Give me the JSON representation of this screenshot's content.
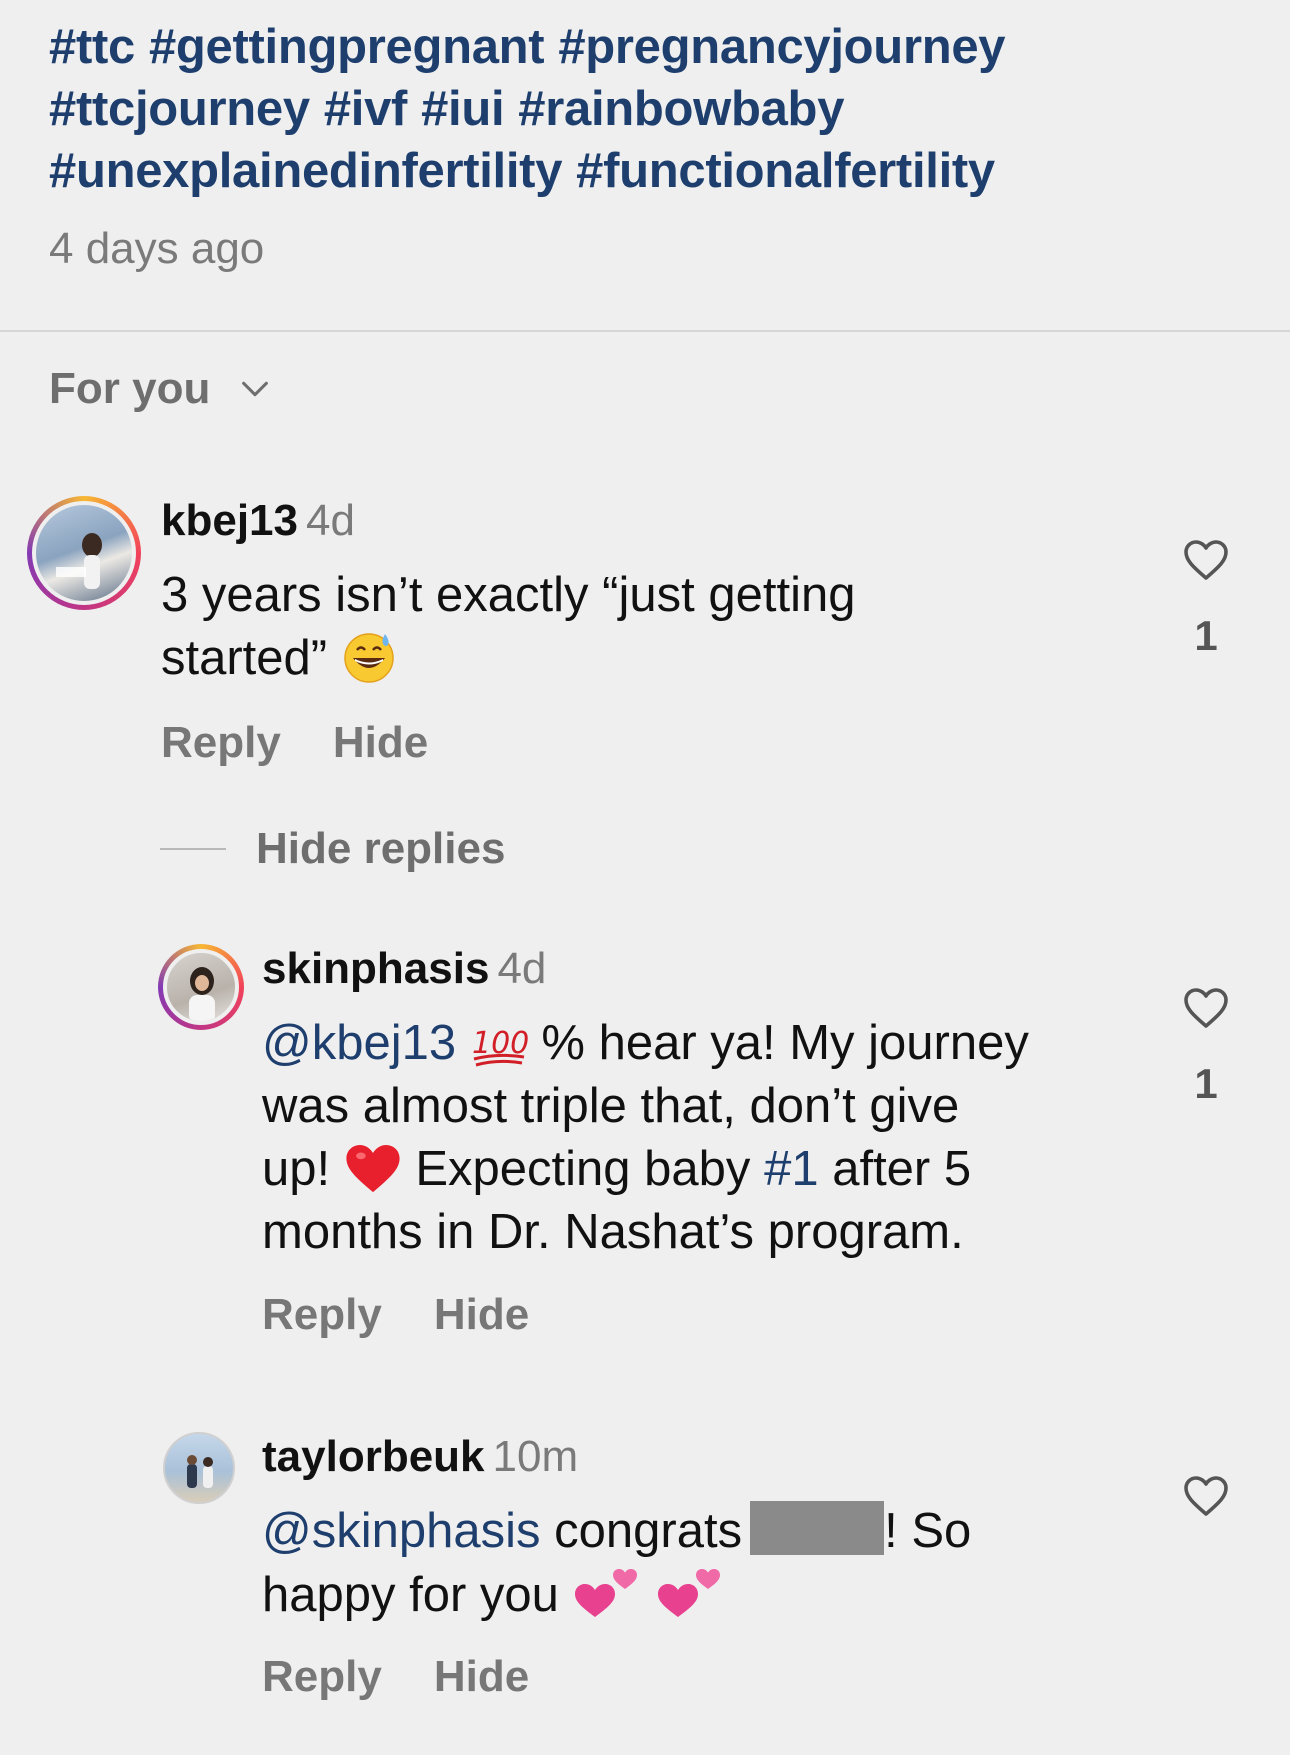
{
  "post": {
    "hashtags": [
      "#ttc",
      "#gettingpregnant",
      "#pregnancyjourney",
      "#ttcjourney",
      "#ivf",
      "#iui",
      "#rainbowbaby",
      "#unexplainedinfertility",
      "#functionalfertility"
    ],
    "time": "4 days ago"
  },
  "sort": {
    "label": "For you"
  },
  "comments": [
    {
      "user": "kbej13",
      "time": "4d",
      "text_line1": "3 years isn’t exactly “just getting",
      "text_line2": "started”",
      "emoji": "grinning-face-with-sweat",
      "likes": "1",
      "reply": "Reply",
      "hide": "Hide"
    }
  ],
  "hide_replies": "Hide replies",
  "replies": [
    {
      "user": "skinphasis",
      "time": "4d",
      "mention": "@kbej13",
      "emoji1": "hundred-points",
      "text_a": "% hear ya! My journey",
      "text_b": "was almost triple that, don’t give",
      "text_c": "up!",
      "emoji2": "red-heart",
      "text_d": "Expecting baby",
      "hashtag": "#1",
      "text_e": "after 5",
      "text_f": "months in Dr. Nashat’s program.",
      "likes": "1",
      "reply": "Reply",
      "hide": "Hide"
    },
    {
      "user": "taylorbeuk",
      "time": "10m",
      "mention": "@skinphasis",
      "text_a": "congrats",
      "text_b": "! So",
      "text_c": "happy for you",
      "emoji": "two-hearts",
      "reply": "Reply",
      "hide": "Hide"
    }
  ],
  "colors": {
    "background": "#efefef",
    "link": "#1e3f6e",
    "muted": "#7a7a7a"
  }
}
